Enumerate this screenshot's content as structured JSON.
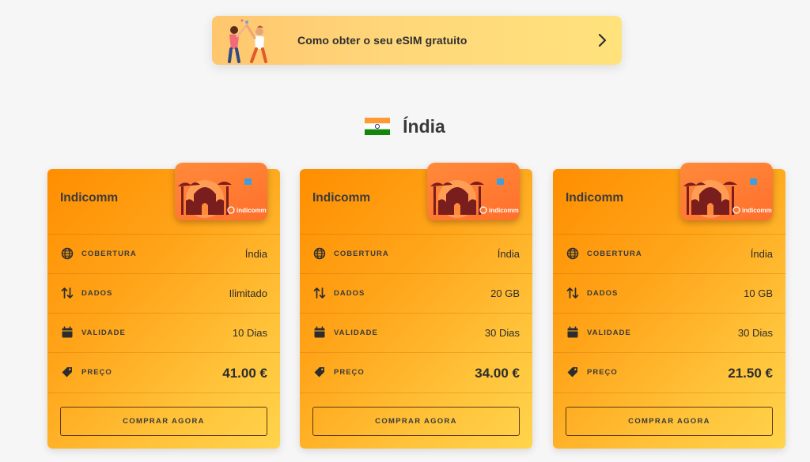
{
  "banner": {
    "text": "Como obter o seu eSIM gratuito",
    "chevron_icon": "chevron-right-icon"
  },
  "country": {
    "name": "Índia",
    "flag_icon": "india-flag-icon"
  },
  "row_labels": {
    "coverage": "COBERTURA",
    "data": "DADOS",
    "validity": "VALIDADE",
    "price": "PREÇO"
  },
  "row_icons": {
    "coverage": "globe-icon",
    "data": "arrows-up-down-icon",
    "validity": "calendar-icon",
    "price": "price-tag-icon"
  },
  "plans": [
    {
      "operator": "Indicomm",
      "coverage": "Índia",
      "data": "Ilimitado",
      "validity": "10 Dias",
      "price": "41.00 €",
      "button": "COMPRAR AGORA",
      "esim_brand": "indicomm"
    },
    {
      "operator": "Indicomm",
      "coverage": "Índia",
      "data": "20 GB",
      "validity": "30 Dias",
      "price": "34.00 €",
      "button": "COMPRAR AGORA",
      "esim_brand": "indicomm"
    },
    {
      "operator": "Indicomm",
      "coverage": "Índia",
      "data": "10 GB",
      "validity": "30 Dias",
      "price": "21.50 €",
      "button": "COMPRAR AGORA",
      "esim_brand": "indicomm"
    }
  ],
  "colors": {
    "card_gradient_start": "#ff8e00",
    "card_gradient_end": "#ffd44c",
    "banner_bg": "#ffd77a",
    "esim_card_bg": "#ff6f2c"
  }
}
